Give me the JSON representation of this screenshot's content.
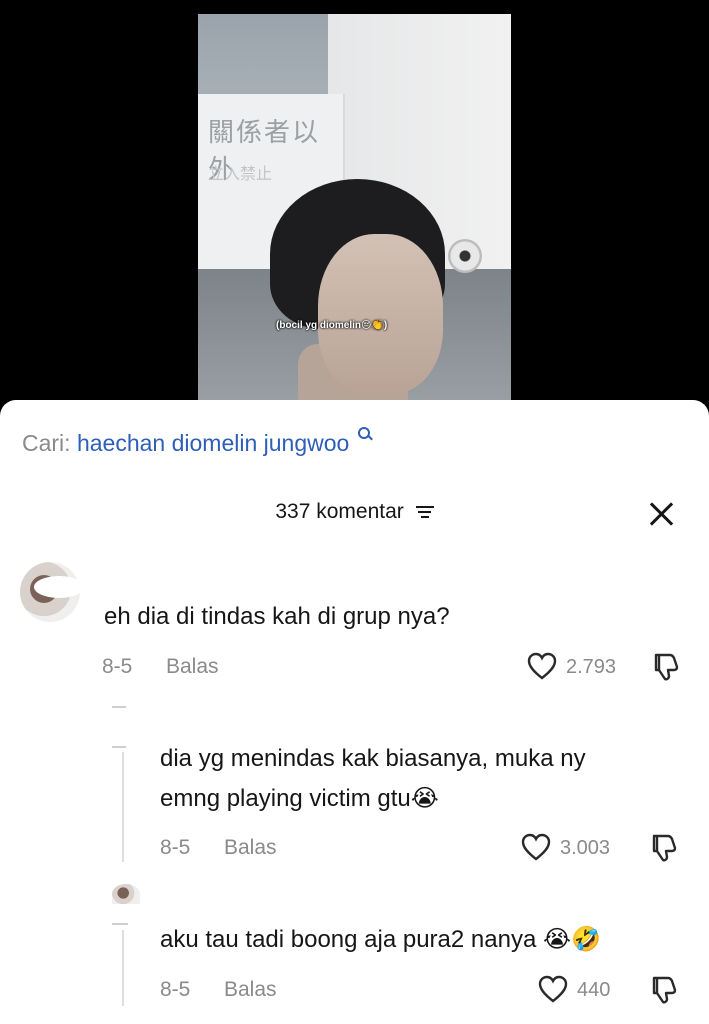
{
  "video": {
    "caption": "(bocil yg diomelin😔👏)",
    "sign_text": "關係者以外",
    "sign_subtext": "立入禁止"
  },
  "search": {
    "label": "Cari:",
    "query": "haechan diomelin jungwoo"
  },
  "header": {
    "comment_count": "337 komentar"
  },
  "comments": [
    {
      "text": "eh dia di tindas kah di grup nya?",
      "date": "8-5",
      "reply_label": "Balas",
      "likes": "2.793"
    }
  ],
  "replies": [
    {
      "text_line1": "dia yg menindas kak biasanya, muka ny",
      "text_line2": "emng playing victim gtu😭",
      "date": "8-5",
      "reply_label": "Balas",
      "likes": "3.003"
    },
    {
      "text": "aku tau tadi boong aja pura2 nanya 😭🤣",
      "date": "8-5",
      "reply_label": "Balas",
      "likes": "440"
    }
  ],
  "colors": {
    "link_blue": "#2d5fb8",
    "muted_gray": "#8a8a8a",
    "text": "#161616"
  }
}
